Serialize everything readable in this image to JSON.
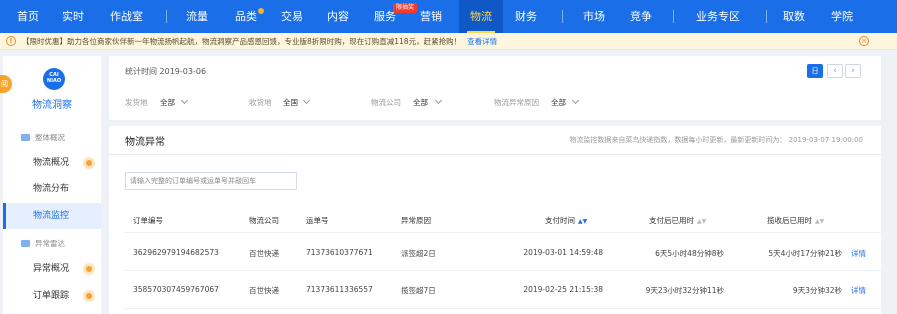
{
  "nav": {
    "items": [
      "首页",
      "实时",
      "作战室",
      "流量",
      "品类",
      "交易",
      "内容",
      "服务",
      "营销",
      "物流",
      "财务",
      "市场",
      "竞争",
      "业务专区",
      "取数",
      "学院"
    ],
    "active": "物流",
    "badge": "限抽奖"
  },
  "notice": {
    "text": "【限时优惠】助力各位商家伙伴新一年物流扬帆起航，物流洞察产品感恩回馈，专业版8折限时购，现在订购直减118元，赶紧抢购！",
    "link": "查看详情",
    "side_badge": "阅"
  },
  "sidebar": {
    "logo_text": "CAI NIAO",
    "title": "物流洞察",
    "groups": [
      {
        "label": "整体概况",
        "items": [
          {
            "label": "物流概况",
            "dot": true
          },
          {
            "label": "物流分布",
            "dot": false
          },
          {
            "label": "物流监控",
            "dot": false,
            "active": true
          }
        ]
      },
      {
        "label": "异常雷达",
        "items": [
          {
            "label": "异常概况",
            "dot": true
          },
          {
            "label": "订单跟踪",
            "dot": true
          }
        ]
      }
    ]
  },
  "filters": {
    "stat_time": "统计时间 2019-03-06",
    "day_button": "日",
    "prev": "‹",
    "next": "›",
    "fields": [
      {
        "label": "发货地",
        "value": "全部"
      },
      {
        "label": "收货地",
        "value": "全国"
      },
      {
        "label": "物流公司",
        "value": "全部"
      },
      {
        "label": "物流异常原因",
        "value": "全部"
      }
    ]
  },
  "panel": {
    "title": "物流异常",
    "note": "物流监控数据来自菜鸟快递指数，数据每小时更新，最新更新时间为： 2019-03-07 19:00:00",
    "search_placeholder": "请输入完整的订单编号或运单号并敲回车"
  },
  "table": {
    "headers": [
      "订单编号",
      "物流公司",
      "运单号",
      "异常原因",
      "支付时间",
      "支付后已用时",
      "揽收后已用时"
    ],
    "sort_indicator": "▲▼",
    "rows": [
      [
        "362962979194682573",
        "百世快递",
        "71373610377671",
        "派签超2日",
        "2019-03-01 14:59:48",
        "6天5小时48分钟8秒",
        "5天4小时17分钟21秒",
        "详情"
      ],
      [
        "358570307459767067",
        "百世快递",
        "71373611336557",
        "揽签超7日",
        "2019-02-25 21:15:38",
        "9天23小时32分钟11秒",
        "9天3分钟32秒",
        "详情"
      ]
    ]
  },
  "colors": {
    "brand": "#1a6fe8",
    "accent": "#ffd84d",
    "dot": "#f7a42c",
    "notice_bg": "#fdf6df"
  }
}
